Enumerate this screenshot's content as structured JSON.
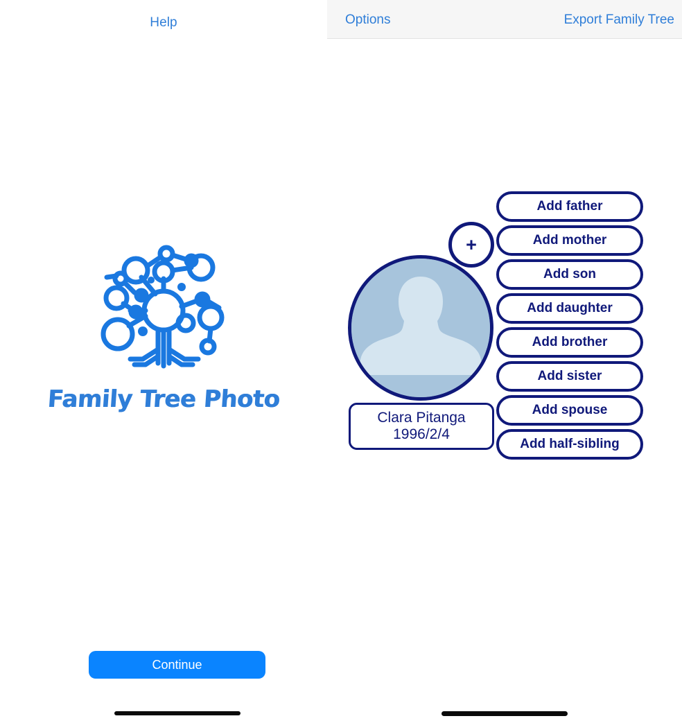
{
  "left_pane": {
    "help_label": "Help",
    "app_title": "Family Tree Photo",
    "logo_icon": "family-tree-network-icon",
    "continue_label": "Continue"
  },
  "right_pane": {
    "toolbar": {
      "options_label": "Options",
      "export_label": "Export Family Tree"
    },
    "person": {
      "avatar_icon": "person-placeholder-avatar-icon",
      "name": "Clara Pitanga",
      "birth_date": "1996/2/4"
    },
    "add_node_icon": "plus-icon",
    "add_node_label": "+",
    "actions": [
      {
        "label": "Add father"
      },
      {
        "label": "Add mother"
      },
      {
        "label": "Add son"
      },
      {
        "label": "Add daughter"
      },
      {
        "label": "Add brother"
      },
      {
        "label": "Add sister"
      },
      {
        "label": "Add spouse"
      },
      {
        "label": "Add half-sibling"
      }
    ]
  },
  "colors": {
    "accent_blue": "#2f7ed8",
    "continue_blue": "#0a84ff",
    "navy": "#10197a",
    "avatar_bg": "#a7c4dc",
    "toolbar_bg": "#f6f6f6"
  }
}
